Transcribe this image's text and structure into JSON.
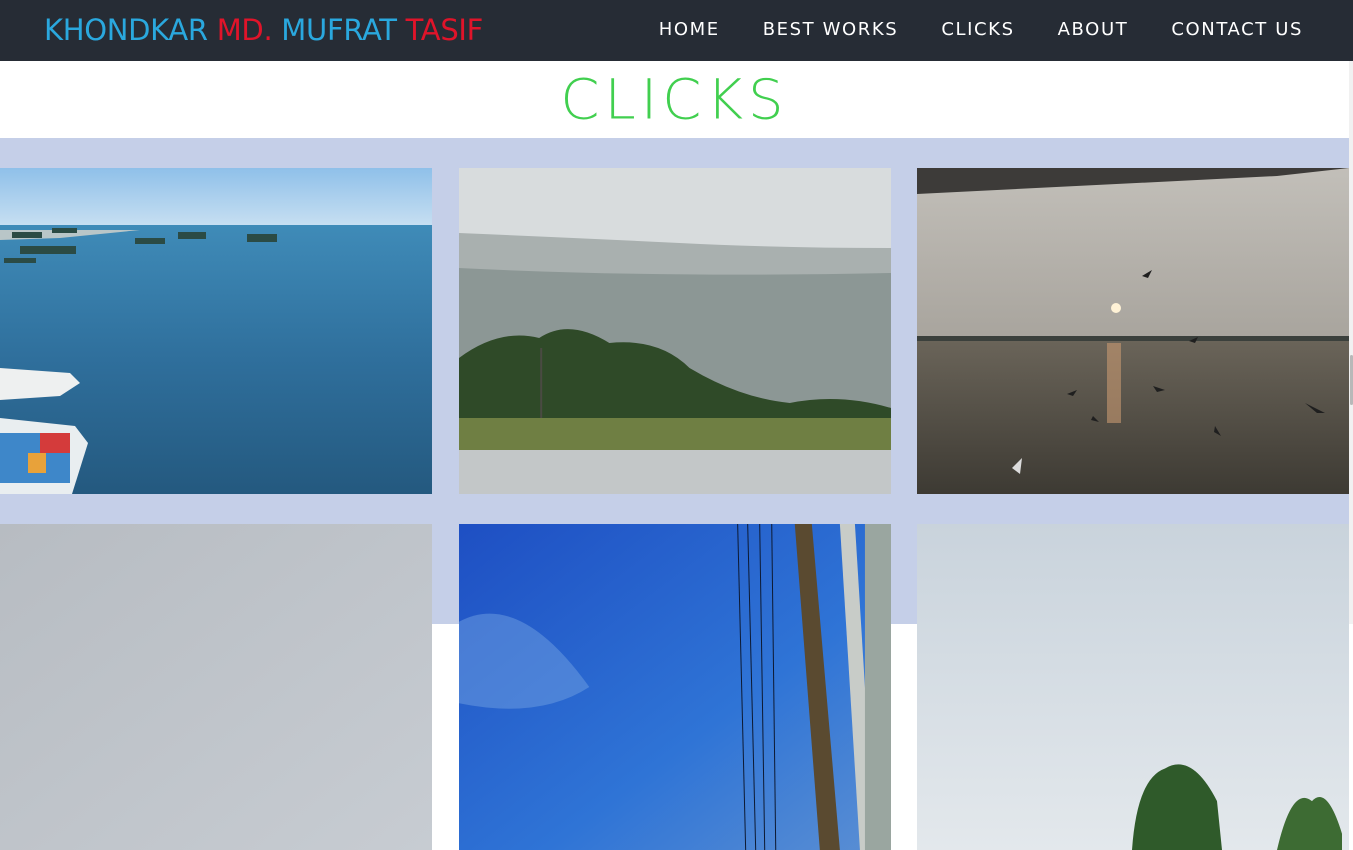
{
  "brand": {
    "part1": "KHONDKAR ",
    "part2": "MD. ",
    "part3": "MUFRAT ",
    "part4": "TASIF",
    "color_blue": "#2aa8de",
    "color_red": "#e0142a"
  },
  "nav": {
    "items": [
      {
        "label": "HOME"
      },
      {
        "label": "BEST WORKS"
      },
      {
        "label": "CLICKS"
      },
      {
        "label": "ABOUT"
      },
      {
        "label": "CONTACT US"
      }
    ]
  },
  "page": {
    "title": "CLICKS",
    "title_color": "#41cf4f",
    "gallery_bg": "#c5cfe8",
    "navbar_bg": "#262c35"
  },
  "gallery": {
    "photos": [
      {
        "name": "photo-sea-boats"
      },
      {
        "name": "photo-misty-hills"
      },
      {
        "name": "photo-sunset-birds"
      },
      {
        "name": "photo-foggy-sky"
      },
      {
        "name": "photo-blue-sky-pole"
      },
      {
        "name": "photo-trees-cloudy"
      }
    ]
  }
}
